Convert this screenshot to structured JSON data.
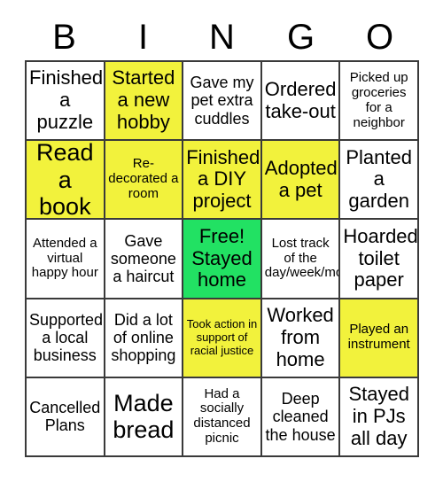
{
  "card": {
    "title_letters": [
      "B",
      "I",
      "N",
      "G",
      "O"
    ],
    "colors": {
      "yellow": "#f2f23c",
      "green": "#22e163",
      "white": "#ffffff",
      "grid_line": "#3a3a3a",
      "text": "#000000"
    },
    "rows": [
      [
        {
          "text": "Finished a puzzle",
          "fill": "white",
          "size": "lg",
          "marked": false
        },
        {
          "text": "Started a new hobby",
          "fill": "yellow",
          "size": "lg",
          "marked": true
        },
        {
          "text": "Gave my pet extra cuddles",
          "fill": "white",
          "size": "md",
          "marked": false
        },
        {
          "text": "Ordered take-out",
          "fill": "white",
          "size": "lg",
          "marked": false
        },
        {
          "text": "Picked up groceries for a neighbor",
          "fill": "white",
          "size": "sm",
          "marked": false
        }
      ],
      [
        {
          "text": "Read a book",
          "fill": "yellow",
          "size": "xl",
          "marked": true
        },
        {
          "text": "Re-decorated a room",
          "fill": "yellow",
          "size": "sm",
          "marked": true
        },
        {
          "text": "Finished a DIY project",
          "fill": "yellow",
          "size": "lg",
          "marked": true
        },
        {
          "text": "Adopted a pet",
          "fill": "yellow",
          "size": "lg",
          "marked": true
        },
        {
          "text": "Planted a garden",
          "fill": "white",
          "size": "lg",
          "marked": false
        }
      ],
      [
        {
          "text": "Attended a virtual happy hour",
          "fill": "white",
          "size": "sm",
          "marked": false
        },
        {
          "text": "Gave someone a haircut",
          "fill": "white",
          "size": "md",
          "marked": false
        },
        {
          "text": "Free! Stayed home",
          "fill": "green",
          "size": "lg",
          "marked": true
        },
        {
          "text": "Lost track of the day/week/month",
          "fill": "white",
          "size": "sm",
          "marked": false
        },
        {
          "text": "Hoarded toilet paper",
          "fill": "white",
          "size": "lg",
          "marked": false
        }
      ],
      [
        {
          "text": "Supported a local business",
          "fill": "white",
          "size": "md",
          "marked": false
        },
        {
          "text": "Did a lot of online shopping",
          "fill": "white",
          "size": "md",
          "marked": false
        },
        {
          "text": "Took action in support of racial justice",
          "fill": "yellow",
          "size": "xs",
          "marked": true
        },
        {
          "text": "Worked from home",
          "fill": "white",
          "size": "lg",
          "marked": false
        },
        {
          "text": "Played an instrument",
          "fill": "yellow",
          "size": "sm",
          "marked": true
        }
      ],
      [
        {
          "text": "Cancelled Plans",
          "fill": "white",
          "size": "md",
          "marked": false
        },
        {
          "text": "Made bread",
          "fill": "white",
          "size": "xl",
          "marked": false
        },
        {
          "text": "Had a socially distanced picnic",
          "fill": "white",
          "size": "sm",
          "marked": false
        },
        {
          "text": "Deep cleaned the house",
          "fill": "white",
          "size": "md",
          "marked": false
        },
        {
          "text": "Stayed in PJs all day",
          "fill": "white",
          "size": "lg",
          "marked": false
        }
      ]
    ]
  }
}
